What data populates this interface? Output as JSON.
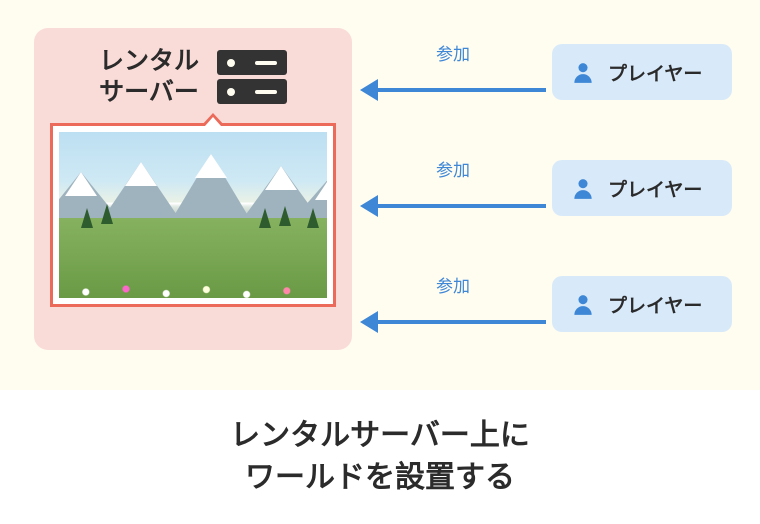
{
  "server": {
    "title_line1": "レンタル",
    "title_line2": "サーバー"
  },
  "arrows": [
    {
      "label": "参加"
    },
    {
      "label": "参加"
    },
    {
      "label": "参加"
    }
  ],
  "players": [
    {
      "label": "プレイヤー"
    },
    {
      "label": "プレイヤー"
    },
    {
      "label": "プレイヤー"
    }
  ],
  "caption": {
    "line1": "レンタルサーバー上に",
    "line2": "ワールドを設置する"
  }
}
